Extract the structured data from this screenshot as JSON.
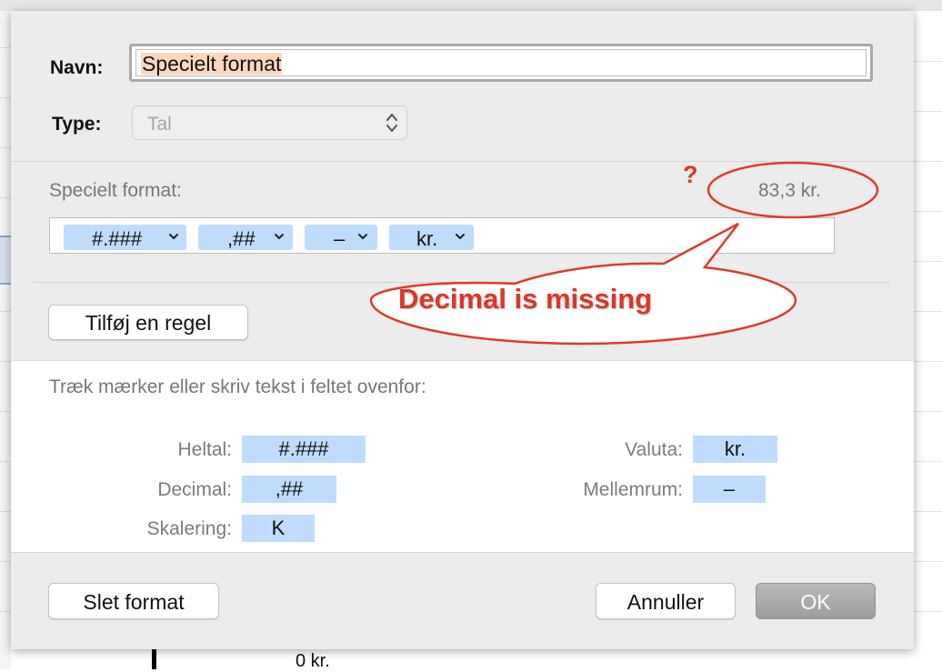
{
  "dialog": {
    "name_label": "Navn:",
    "name_value": "Specielt format",
    "type_label": "Type:",
    "type_value": "Tal",
    "custom_format_label": "Specielt format:",
    "preview_value": "83,3 kr.",
    "tokens": [
      {
        "label": "#.###"
      },
      {
        "label": ",##"
      },
      {
        "label": "–"
      },
      {
        "label": "kr."
      }
    ],
    "add_rule_button": "Tilføj en regel",
    "drag_instruction": "Træk mærker eller skriv tekst i feltet ovenfor:",
    "palette": {
      "integer_label": "Heltal:",
      "integer_token": "#.###",
      "decimal_label": "Decimal:",
      "decimal_token": ",##",
      "scaling_label": "Skalering:",
      "scaling_token": "K",
      "currency_label": "Valuta:",
      "currency_token": "kr.",
      "space_label": "Mellemrum:",
      "space_token": "–"
    },
    "delete_format_button": "Slet format",
    "cancel_button": "Annuller",
    "ok_button": "OK"
  },
  "annotation": {
    "question_mark": "?",
    "callout_text": "Decimal is missing",
    "color": "#e23a2a"
  },
  "background": {
    "axis_label": "0 kr."
  },
  "colors": {
    "token_blue": "#bfdcfd",
    "selection_highlight": "#fcd7bf",
    "sheet_bg": "#ececec"
  }
}
